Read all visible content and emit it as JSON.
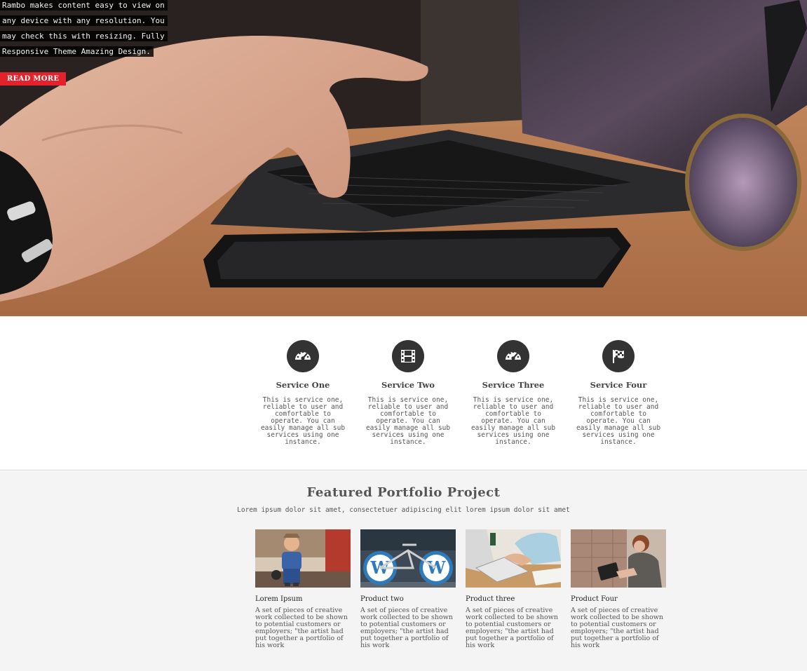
{
  "hero": {
    "caption_lines": [
      "Rambo makes content easy to view on",
      "any device with any resolution. You",
      "may check this with resizing. Fully",
      "Responsive Theme Amazing Design."
    ],
    "read_more_label": "READ MORE"
  },
  "services": [
    {
      "title": "Service One",
      "icon": "dashboard-icon",
      "description": "This is service one, reliable to user and comfortable to operate. You can easily manage all sub services using one instance."
    },
    {
      "title": "Service Two",
      "icon": "film-icon",
      "description": "This is service one, reliable to user and comfortable to operate. You can easily manage all sub services using one instance."
    },
    {
      "title": "Service Three",
      "icon": "dashboard-icon",
      "description": "This is service one, reliable to user and comfortable to operate. You can easily manage all sub services using one instance."
    },
    {
      "title": "Service Four",
      "icon": "flag-icon",
      "description": "This is service one, reliable to user and comfortable to operate. You can easily manage all sub services using one instance."
    }
  ],
  "portfolio": {
    "title": "Featured Portfolio Project",
    "subtitle": "Lorem ipsum dolor sit amet, consectetuer adipiscing elit lorem ipsum dolor sit amet",
    "items": [
      {
        "title": "Lorem Ipsum",
        "description": "A set of pieces of creative work collected to be shown to potential customers or employers; \"the artist had put together a portfolio of his work"
      },
      {
        "title": "Product two",
        "description": "A set of pieces of creative work collected to be shown to potential customers or employers; \"the artist had put together a portfolio of his work"
      },
      {
        "title": "Product three",
        "description": "A set of pieces of creative work collected to be shown to potential customers or employers; \"the artist had put together a portfolio of his work"
      },
      {
        "title": "Product Four",
        "description": "A set of pieces of creative work collected to be shown to potential customers or employers; \"the artist had put together a portfolio of his work"
      }
    ]
  },
  "colors": {
    "accent": "#e3222b",
    "icon_circle": "#333333",
    "portfolio_bg": "#f4f4f4"
  }
}
